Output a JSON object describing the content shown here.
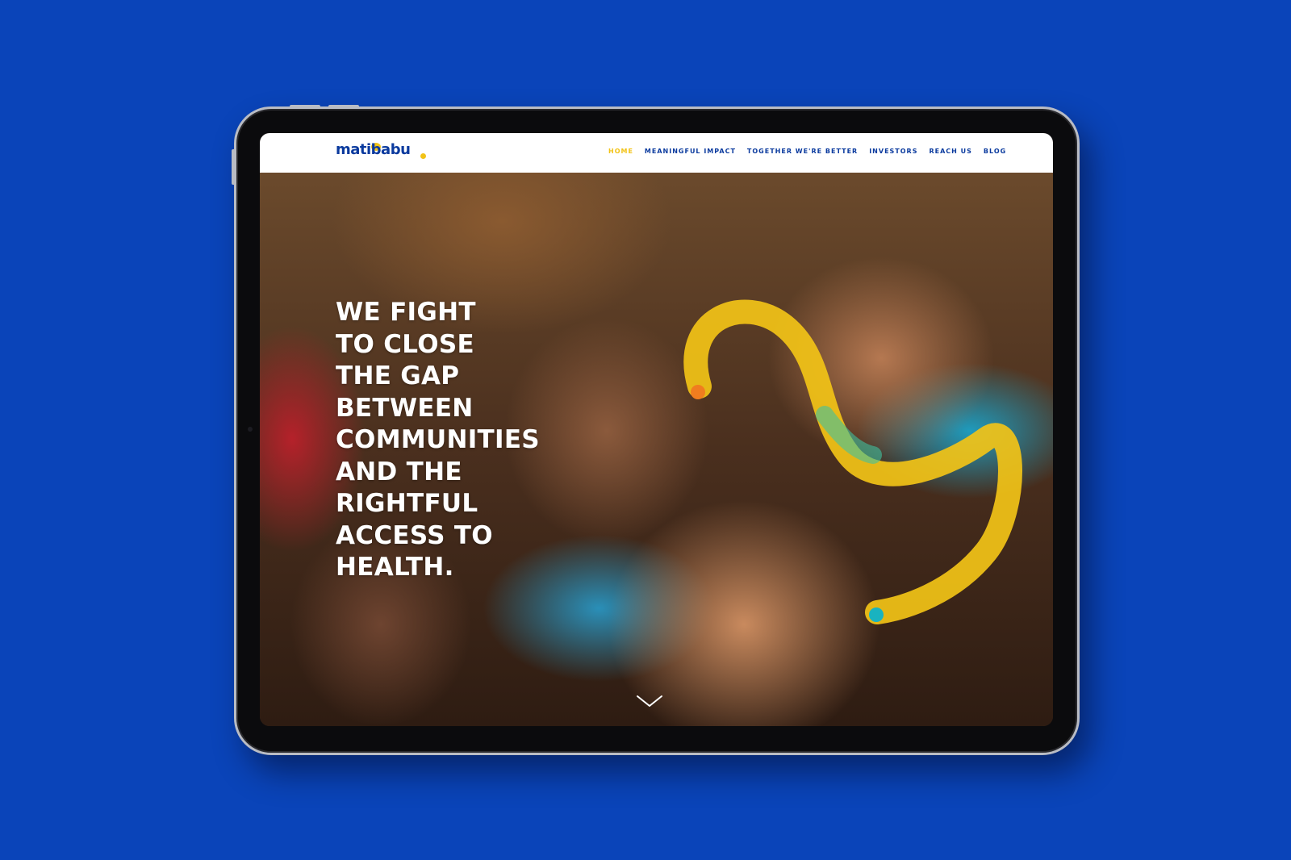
{
  "logo": {
    "text": "matibabu"
  },
  "nav": {
    "items": [
      {
        "label": "HOME",
        "active": true
      },
      {
        "label": "MEANINGFUL IMPACT",
        "active": false
      },
      {
        "label": "TOGETHER WE'RE BETTER",
        "active": false
      },
      {
        "label": "INVESTORS",
        "active": false
      },
      {
        "label": "REACH US",
        "active": false
      },
      {
        "label": "BLOG",
        "active": false
      }
    ]
  },
  "hero": {
    "headline_lines": [
      "WE FIGHT",
      "TO CLOSE",
      "THE GAP",
      "BETWEEN",
      "COMMUNITIES",
      "AND THE",
      "RIGHTFUL",
      "ACCESS TO",
      "HEALTH."
    ],
    "scroll_icon": "chevron-down-icon"
  },
  "colors": {
    "background": "#0a44b9",
    "brand_blue": "#0a3a9e",
    "accent_yellow": "#f2c317",
    "accent_orange": "#f07d1f",
    "accent_teal": "#19b3c0"
  }
}
